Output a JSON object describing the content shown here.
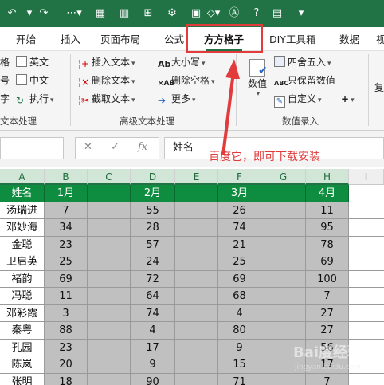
{
  "colors": {
    "accent": "#217346",
    "header_fill": "#0e8c3f",
    "annotation": "#e23b3b"
  },
  "tabs": [
    "开始",
    "插入",
    "页面布局",
    "公式",
    "方方格子",
    "DIY工具箱",
    "数据",
    "视"
  ],
  "active_tab": "方方格子",
  "ribbon": {
    "left_items": [
      "英文",
      "中文",
      "执行"
    ],
    "left_prefix": [
      "格",
      "号",
      "字"
    ],
    "adv_items": [
      "插入文本",
      "删除文本",
      "截取文本",
      "大小写",
      "删除空格",
      "更多"
    ],
    "numeric_button": "数值",
    "num_items": [
      "四舍五入",
      "只保留数值",
      "自定义"
    ],
    "group_labels": [
      "文本处理",
      "高级文本处理",
      "数值录入"
    ],
    "right_partial": "复"
  },
  "formula_bar": {
    "value": "姓名",
    "fx": "fx"
  },
  "columns": [
    "A",
    "B",
    "C",
    "D",
    "E",
    "F",
    "G",
    "H",
    "I"
  ],
  "table": {
    "header": [
      "姓名",
      "1月",
      "",
      "2月",
      "",
      "3月",
      "",
      "4月",
      ""
    ],
    "rows": [
      [
        "汤瑞进",
        "7",
        "",
        "55",
        "",
        "26",
        "",
        "11"
      ],
      [
        "邓妙海",
        "34",
        "",
        "28",
        "",
        "74",
        "",
        "95"
      ],
      [
        "金聪",
        "23",
        "",
        "57",
        "",
        "21",
        "",
        "78"
      ],
      [
        "卫启英",
        "25",
        "",
        "24",
        "",
        "25",
        "",
        "69"
      ],
      [
        "褚韵",
        "69",
        "",
        "72",
        "",
        "69",
        "",
        "100"
      ],
      [
        "冯聪",
        "11",
        "",
        "64",
        "",
        "68",
        "",
        "7"
      ],
      [
        "邓彩霞",
        "3",
        "",
        "74",
        "",
        "4",
        "",
        "27"
      ],
      [
        "秦粤",
        "88",
        "",
        "4",
        "",
        "80",
        "",
        "27"
      ],
      [
        "孔园",
        "23",
        "",
        "17",
        "",
        "9",
        "",
        "56"
      ],
      [
        "陈岚",
        "20",
        "",
        "9",
        "",
        "15",
        "",
        "17"
      ],
      [
        "张明",
        "18",
        "",
        "90",
        "",
        "71",
        "",
        "7"
      ]
    ]
  },
  "annotation_text": "百度它，即可下载安装",
  "watermark": {
    "brand": "Bai度经验",
    "url": "jingyan.baidu.com"
  }
}
